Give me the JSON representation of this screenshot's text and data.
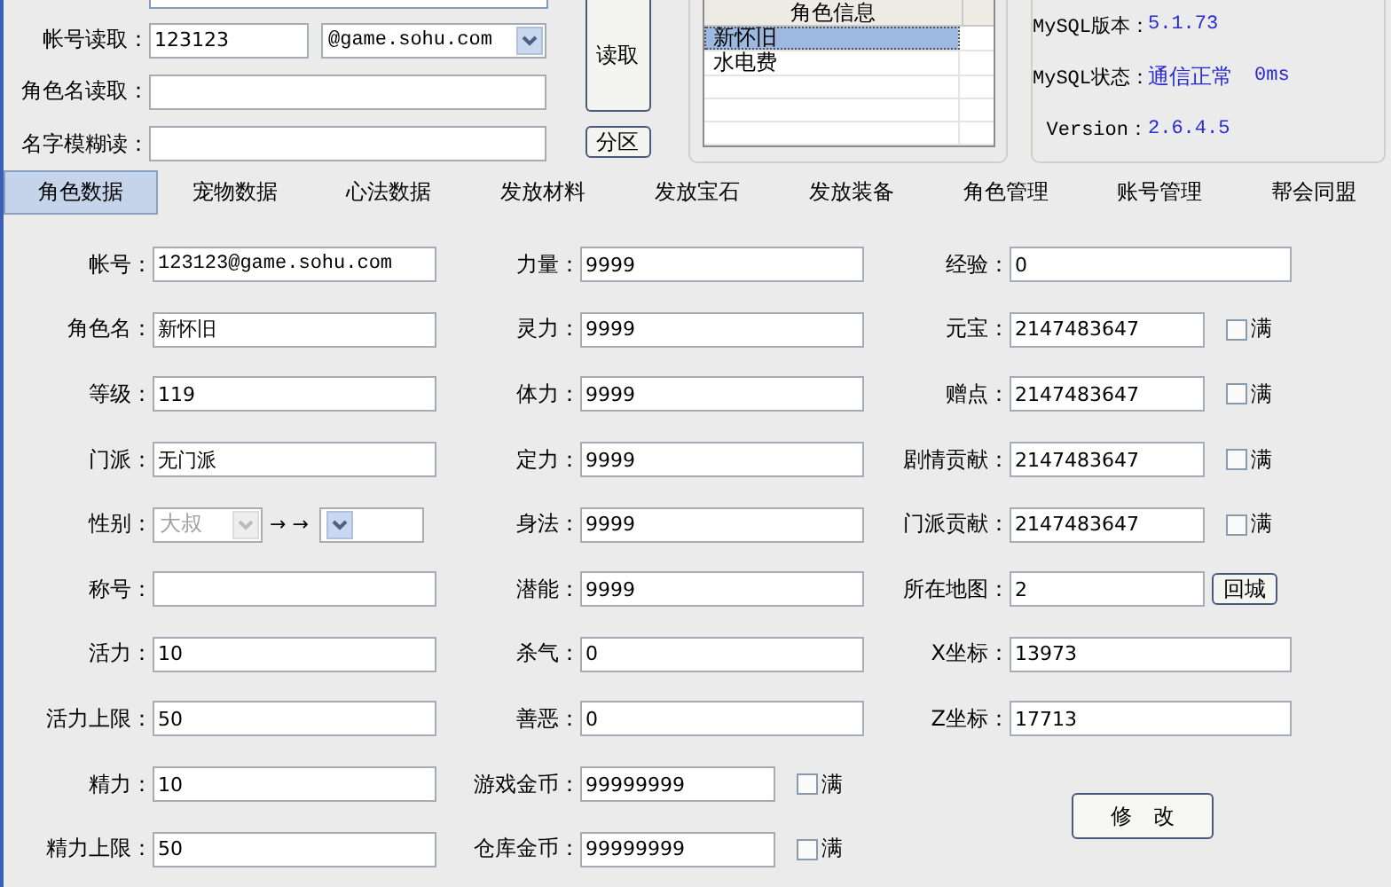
{
  "account_read": {
    "label": "帐号读取：",
    "value": "123123",
    "domain": "@game.sohu.com"
  },
  "role_read": {
    "label": "角色名读取："
  },
  "fuzzy_read": {
    "label": "名字模糊读："
  },
  "read_button": "读取",
  "partition_button": "分区",
  "role_list": {
    "header": "角色信息",
    "items": [
      {
        "name": "新怀旧",
        "selected": true
      },
      {
        "name": "水电费",
        "selected": false
      }
    ]
  },
  "mysql": [
    {
      "label": "MySQL版本：",
      "value": "5.1.73"
    },
    {
      "label": "MySQL状态：",
      "value": "通信正常",
      "extra": "0ms"
    },
    {
      "label": "Version：",
      "value": "2.6.4.5"
    }
  ],
  "tabs": [
    {
      "label": "角色数据",
      "selected": true
    },
    {
      "label": "宠物数据",
      "selected": false
    },
    {
      "label": "心法数据",
      "selected": false
    },
    {
      "label": "发放材料",
      "selected": false
    },
    {
      "label": "发放宝石",
      "selected": false
    },
    {
      "label": "发放装备",
      "selected": false
    },
    {
      "label": "角色管理",
      "selected": false
    },
    {
      "label": "账号管理",
      "selected": false
    },
    {
      "label": "帮会同盟",
      "selected": false
    }
  ],
  "columns": [
    {
      "fields": [
        {
          "kind": "text",
          "label": "帐号：",
          "value": "123123@game.sohu.com"
        },
        {
          "kind": "text",
          "label": "角色名：",
          "value": "新怀旧"
        },
        {
          "kind": "text",
          "label": "等级：",
          "value": "119"
        },
        {
          "kind": "text",
          "label": "门派：",
          "value": "无门派"
        },
        {
          "kind": "gender",
          "label": "性别：",
          "value": "大叔",
          "disabled": true,
          "arrows": "→ →"
        },
        {
          "kind": "text",
          "label": "称号："
        },
        {
          "kind": "text",
          "label": "活力：",
          "value": "10"
        },
        {
          "kind": "text",
          "label": "活力上限：",
          "value": "50"
        },
        {
          "kind": "text",
          "label": "精力：",
          "value": "10"
        },
        {
          "kind": "text",
          "label": "精力上限：",
          "value": "50"
        }
      ]
    },
    {
      "fields": [
        {
          "kind": "text",
          "label": "力量：",
          "value": "9999"
        },
        {
          "kind": "text",
          "label": "灵力：",
          "value": "9999"
        },
        {
          "kind": "text",
          "label": "体力：",
          "value": "9999"
        },
        {
          "kind": "text",
          "label": "定力：",
          "value": "9999"
        },
        {
          "kind": "text",
          "label": "身法：",
          "value": "9999"
        },
        {
          "kind": "text",
          "label": "潜能：",
          "value": "9999"
        },
        {
          "kind": "text",
          "label": "杀气：",
          "value": "0"
        },
        {
          "kind": "text",
          "label": "善恶：",
          "value": "0"
        },
        {
          "kind": "full",
          "label": "游戏金币：",
          "value": "99999999",
          "check": "满",
          "checked": false
        },
        {
          "kind": "full",
          "label": "仓库金币：",
          "value": "99999999",
          "check": "满",
          "checked": false
        }
      ]
    },
    {
      "fields": [
        {
          "kind": "text",
          "label": "经验：",
          "value": "0"
        },
        {
          "kind": "full",
          "label": "元宝：",
          "value": "2147483647",
          "check": "满",
          "checked": false
        },
        {
          "kind": "full",
          "label": "赠点：",
          "value": "2147483647",
          "check": "满",
          "checked": false
        },
        {
          "kind": "full",
          "label": "剧情贡献：",
          "value": "2147483647",
          "check": "满",
          "checked": false
        },
        {
          "kind": "full",
          "label": "门派贡献：",
          "value": "2147483647",
          "check": "满",
          "checked": false
        },
        {
          "kind": "map",
          "label": "所在地图：",
          "value": "2",
          "button": "回城"
        },
        {
          "kind": "text",
          "label": "X坐标：",
          "value": "13973"
        },
        {
          "kind": "text",
          "label": "Z坐标：",
          "value": "17713"
        },
        {
          "kind": "button",
          "label": "修　改"
        }
      ]
    }
  ]
}
